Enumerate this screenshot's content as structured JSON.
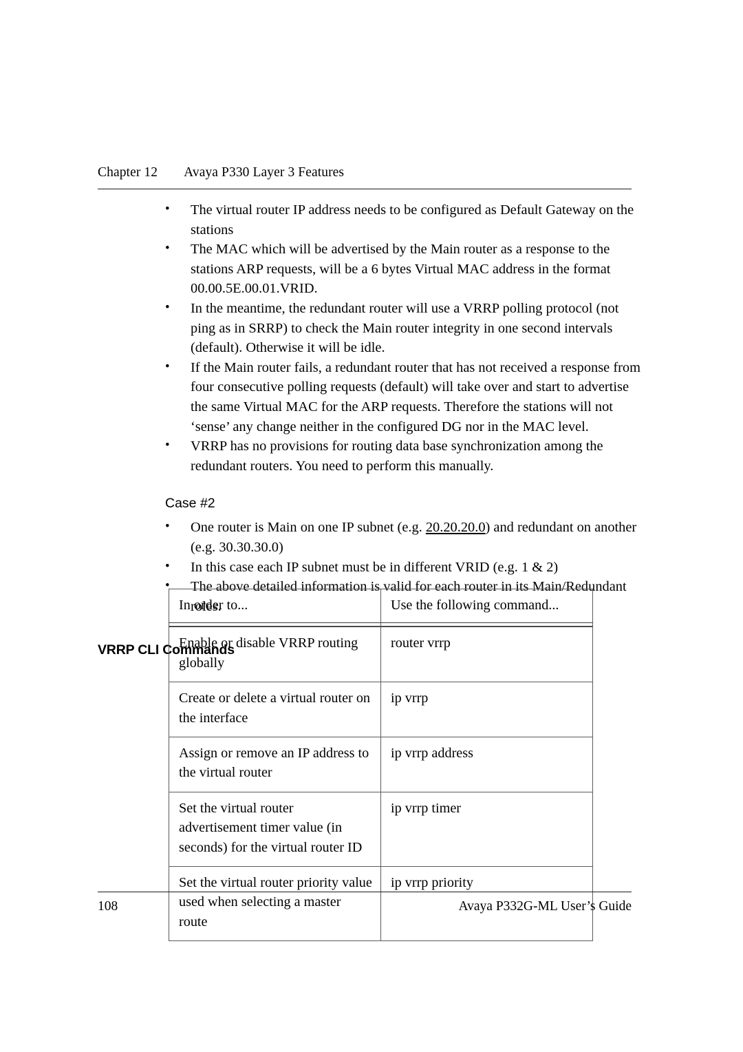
{
  "running_head": {
    "chapter_number": "Chapter 12",
    "chapter_title": "Avaya P330 Layer 3 Features"
  },
  "body": {
    "bullets_group_1": [
      "The virtual router IP address needs to be configured as Default Gateway on the stations",
      "The MAC which will be advertised by the Main router as a response to the stations ARP requests, will be a 6 bytes Virtual MAC address in the format 00.00.5E.00.01.VRID.",
      "In the meantime, the redundant router will use a VRRP polling protocol (not ping as in SRRP) to check the Main router integrity in one second intervals (default). Otherwise it will be idle.",
      "If the Main router fails, a redundant router that has not received a response from four consecutive polling requests (default) will take over and start to advertise the same Virtual MAC for the ARP requests. Therefore the stations will not ‘sense’ any change neither in the configured DG nor in the MAC level.",
      "VRRP has no provisions for routing data base synchronization among the redundant routers. You need to perform this manually."
    ],
    "case_heading": "Case #2",
    "bullets_group_2": {
      "item_1_prefix": "One router is Main on one IP subnet (e.g. ",
      "item_1_underlined": "20.20.20.0",
      "item_1_suffix": ") and redundant on another (e.g. 30.30.30.0)",
      "item_2": "In this case each IP subnet must be in different VRID (e.g. 1 & 2)",
      "item_3": "The above detailed information is valid for each router in its Main/Redundant roles."
    },
    "section_heading": "VRRP CLI Commands"
  },
  "table": {
    "headers": [
      "In order to...",
      "Use the following command..."
    ],
    "rows": [
      [
        "Enable or disable VRRP routing globally",
        "router vrrp"
      ],
      [
        "Create or delete a virtual router on the interface",
        "ip vrrp"
      ],
      [
        "Assign or remove an IP address to the virtual router",
        "ip vrrp address"
      ],
      [
        "Set the virtual router advertisement timer value (in seconds) for the virtual router ID",
        "ip vrrp timer"
      ],
      [
        "Set the virtual router priority value used when selecting a master route",
        "ip vrrp priority"
      ]
    ]
  },
  "footer": {
    "page_number": "108",
    "guide_title": "Avaya P332G-ML User’s Guide"
  }
}
